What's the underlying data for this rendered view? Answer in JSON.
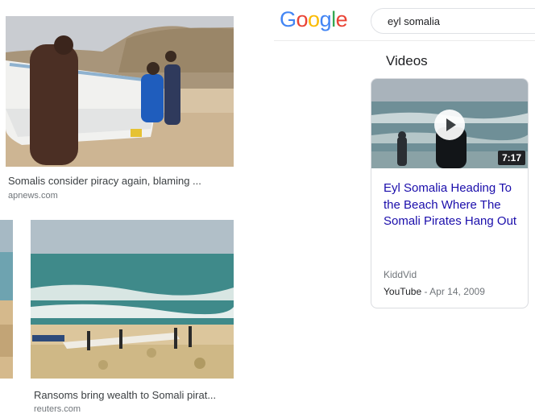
{
  "results": {
    "top": {
      "caption": "Somalis consider piracy again, blaming ...",
      "source": "apnews.com"
    },
    "bottom": {
      "caption": "Ransoms bring wealth to Somali pirat...",
      "source": "reuters.com"
    }
  },
  "header": {
    "logo_letters": [
      {
        "ch": "G",
        "color": "#4285F4"
      },
      {
        "ch": "o",
        "color": "#EA4335"
      },
      {
        "ch": "o",
        "color": "#FBBC05"
      },
      {
        "ch": "g",
        "color": "#4285F4"
      },
      {
        "ch": "l",
        "color": "#34A853"
      },
      {
        "ch": "e",
        "color": "#EA4335"
      }
    ],
    "search_query": "eyl somalia"
  },
  "videos": {
    "heading": "Videos",
    "card": {
      "duration": "7:17",
      "title": "Eyl Somalia Heading To the Beach Where The Somali Pirates Hang Out",
      "channel": "KiddVid",
      "platform": "YouTube",
      "separator": " - ",
      "date": "Apr 14, 2009"
    }
  }
}
